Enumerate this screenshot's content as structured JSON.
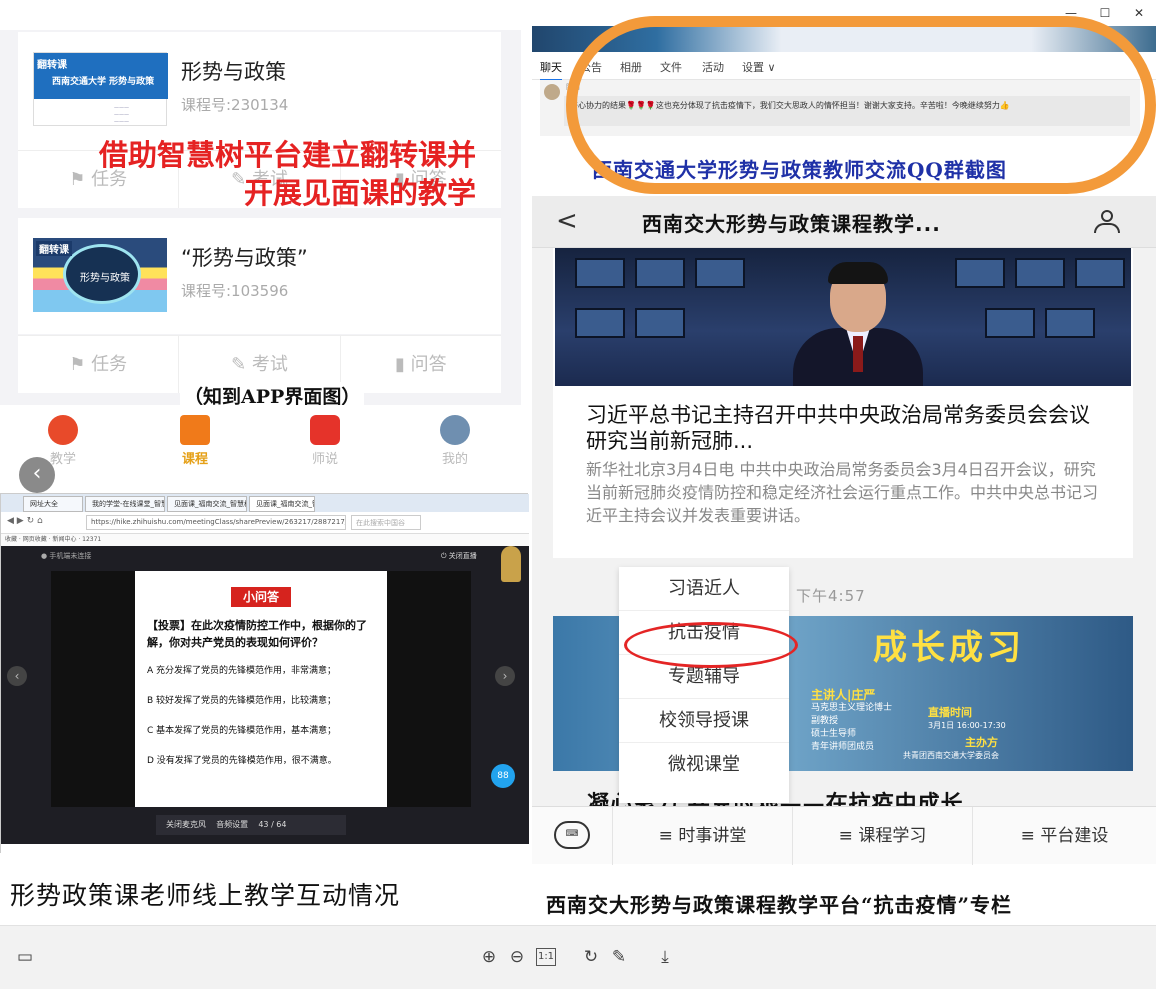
{
  "window": {
    "min_glyph": "—",
    "max_glyph": "☐",
    "close_glyph": "✕"
  },
  "zhidao_app": {
    "courses": [
      {
        "cover_tag": "翻转课",
        "cover_title": "西南交通大学 形势与政策",
        "title": "形势与政策",
        "course_no": "课程号:230134"
      },
      {
        "cover_tag": "翻转课",
        "cover_title": "形势与政策",
        "title": "“形势与政策”",
        "course_no": "课程号:103596"
      }
    ],
    "actions": [
      "任务",
      "考试",
      "问答"
    ],
    "overlay_text": "借助智慧树平台建立翻转课并开展见面课的教学",
    "caption": "（知到APP界面图）",
    "tabs": [
      {
        "label": "教学",
        "color": "#e84a2a"
      },
      {
        "label": "课程",
        "color": "#f07a1a"
      },
      {
        "label": "师说",
        "color": "#e5332a"
      },
      {
        "label": "我的",
        "color": "#6f8fb0"
      }
    ],
    "back_glyph": "‹"
  },
  "browser": {
    "tabs": [
      "网址大全",
      "我的学堂-在线课堂_智慧树",
      "见面课_福南交流_智慧树",
      "见面课_福南交流_智慧树"
    ],
    "url": "https://hike.zhihuishu.com/meetingClass/sharePreview/263217/2887217/27vN",
    "search_placeholder": "在此搜索中国谷",
    "bookmarks": "收藏 · 网页收藏 · 新闻中心 · 12371",
    "top_left": "● 手机端未连接",
    "top_right": "⏻ 关闭直播",
    "quiz": {
      "badge": "小问答",
      "question": "【投票】在此次疫情防控工作中，根据你的了解，你对共产党员的表现如何评价？",
      "options": [
        "A 充分发挥了党员的先锋模范作用，非常满意；",
        "B 较好发挥了党员的先锋模范作用，比较满意；",
        "C 基本发挥了党员的先锋模范作用，基本满意；",
        "D 没有发挥了党员的先锋模范作用，很不满意。"
      ]
    },
    "controls": {
      "mic": "关闭麦克风",
      "audio": "音频设置",
      "page": "43 / 64"
    },
    "round_btn": "88"
  },
  "caption_left": "形势政策课老师线上教学互动情况",
  "qq": {
    "tabs": [
      "聊天",
      "公告",
      "相册",
      "文件",
      "活动",
      "设置 ∨"
    ],
    "sender": "阿翁",
    "message": "齐心协力的结果🌹🌹🌹这也充分体现了抗击疫情下，我们交大思政人的情怀担当！谢谢大家支持。辛苦啦！今晚继续努力👍",
    "caption": "西南交通大学形势与政策教师交流QQ群截图"
  },
  "phone": {
    "title": "西南交大形势与政策课程教学...",
    "back_glyph": "<",
    "news_title": "习近平总书记主持召开中共中央政治局常务委员会会议 研究当前新冠肺...",
    "news_body": "新华社北京3月4日电 中共中央政治局常务委员会3月4日召开会议，研究当前新冠肺炎疫情防控和稳定经济社会运行重点工作。中共中央总书记习近平主持会议并发表重要讲话。",
    "time": "下午4:57",
    "menu": [
      "习语近人",
      "抗击疫情",
      "专题辅导",
      "校领导授课",
      "微视课堂"
    ],
    "banner": {
      "big": "成长成习",
      "s1": "主讲人|庄严",
      "s2": "马克思主义理论博士\n副教授\n硕士生导师\n青年讲师团成员",
      "s3": "直播时间",
      "s4": "3月1日 16:00-17:30",
      "s5": "主办方",
      "s6": "共青团西南交通大学委员会"
    },
    "banner_title": "凝心聚力 共克时艰——在抗疫中成长",
    "keyboard_glyph": "⌨",
    "footer": [
      "≡ 时事讲堂",
      "≡ 课程学习",
      "≡ 平台建设"
    ]
  },
  "caption_right": "西南交大形势与政策课程教学平台“抗击疫情”专栏",
  "viewer": {
    "icons": [
      "▭",
      "⊕",
      "⊖",
      "1:1",
      "↻",
      "✎",
      "⤓"
    ]
  }
}
